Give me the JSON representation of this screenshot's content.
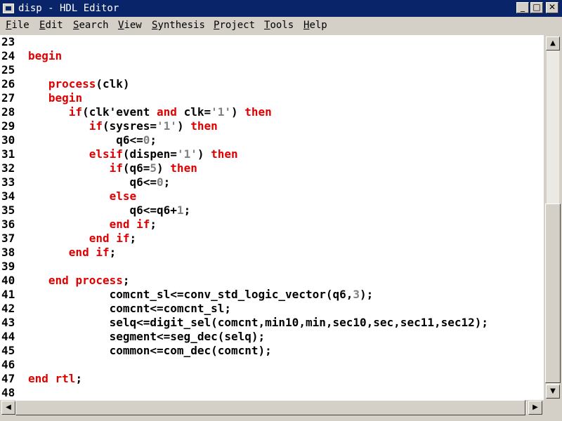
{
  "window": {
    "title": "disp - HDL Editor",
    "minimize_icon": "minimize-icon",
    "maximize_icon": "maximize-icon",
    "close_icon": "close-icon"
  },
  "menu": [
    "File",
    "Edit",
    "Search",
    "View",
    "Synthesis",
    "Project",
    "Tools",
    "Help"
  ],
  "colors": {
    "keyword": "#e00000",
    "text": "#000000",
    "literal": "#808080",
    "titlebar": "#0a246a"
  },
  "editor": {
    "lines": [
      {
        "num": "23",
        "tokens": []
      },
      {
        "num": "24",
        "tokens": [
          {
            "t": "begin",
            "c": "k"
          }
        ]
      },
      {
        "num": "25",
        "tokens": []
      },
      {
        "num": "26",
        "tokens": [
          {
            "t": "   ",
            "c": "n"
          },
          {
            "t": "process",
            "c": "k"
          },
          {
            "t": "(clk)",
            "c": "n"
          }
        ]
      },
      {
        "num": "27",
        "tokens": [
          {
            "t": "   ",
            "c": "n"
          },
          {
            "t": "begin",
            "c": "k"
          }
        ]
      },
      {
        "num": "28",
        "tokens": [
          {
            "t": "      ",
            "c": "n"
          },
          {
            "t": "if",
            "c": "k"
          },
          {
            "t": "(clk'event ",
            "c": "n"
          },
          {
            "t": "and",
            "c": "k"
          },
          {
            "t": " clk=",
            "c": "n"
          },
          {
            "t": "'1'",
            "c": "v"
          },
          {
            "t": ") ",
            "c": "n"
          },
          {
            "t": "then",
            "c": "k"
          }
        ]
      },
      {
        "num": "29",
        "tokens": [
          {
            "t": "         ",
            "c": "n"
          },
          {
            "t": "if",
            "c": "k"
          },
          {
            "t": "(sysres=",
            "c": "n"
          },
          {
            "t": "'1'",
            "c": "v"
          },
          {
            "t": ") ",
            "c": "n"
          },
          {
            "t": "then",
            "c": "k"
          }
        ]
      },
      {
        "num": "30",
        "tokens": [
          {
            "t": "             q6<=",
            "c": "n"
          },
          {
            "t": "0",
            "c": "v"
          },
          {
            "t": ";",
            "c": "n"
          }
        ]
      },
      {
        "num": "31",
        "tokens": [
          {
            "t": "         ",
            "c": "n"
          },
          {
            "t": "elsif",
            "c": "k"
          },
          {
            "t": "(dispen=",
            "c": "n"
          },
          {
            "t": "'1'",
            "c": "v"
          },
          {
            "t": ") ",
            "c": "n"
          },
          {
            "t": "then",
            "c": "k"
          }
        ]
      },
      {
        "num": "32",
        "tokens": [
          {
            "t": "            ",
            "c": "n"
          },
          {
            "t": "if",
            "c": "k"
          },
          {
            "t": "(q6=",
            "c": "n"
          },
          {
            "t": "5",
            "c": "v"
          },
          {
            "t": ") ",
            "c": "n"
          },
          {
            "t": "then",
            "c": "k"
          }
        ]
      },
      {
        "num": "33",
        "tokens": [
          {
            "t": "               q6<=",
            "c": "n"
          },
          {
            "t": "0",
            "c": "v"
          },
          {
            "t": ";",
            "c": "n"
          }
        ]
      },
      {
        "num": "34",
        "tokens": [
          {
            "t": "            ",
            "c": "n"
          },
          {
            "t": "else",
            "c": "k"
          }
        ]
      },
      {
        "num": "35",
        "tokens": [
          {
            "t": "               q6<=q6+",
            "c": "n"
          },
          {
            "t": "1",
            "c": "v"
          },
          {
            "t": ";",
            "c": "n"
          }
        ]
      },
      {
        "num": "36",
        "tokens": [
          {
            "t": "            ",
            "c": "n"
          },
          {
            "t": "end if",
            "c": "k"
          },
          {
            "t": ";",
            "c": "n"
          }
        ]
      },
      {
        "num": "37",
        "tokens": [
          {
            "t": "         ",
            "c": "n"
          },
          {
            "t": "end if",
            "c": "k"
          },
          {
            "t": ";",
            "c": "n"
          }
        ]
      },
      {
        "num": "38",
        "tokens": [
          {
            "t": "      ",
            "c": "n"
          },
          {
            "t": "end if",
            "c": "k"
          },
          {
            "t": ";",
            "c": "n"
          }
        ]
      },
      {
        "num": "39",
        "tokens": []
      },
      {
        "num": "40",
        "tokens": [
          {
            "t": "   ",
            "c": "n"
          },
          {
            "t": "end process",
            "c": "k"
          },
          {
            "t": ";",
            "c": "n"
          }
        ]
      },
      {
        "num": "41",
        "tokens": [
          {
            "t": "            comcnt_sl<=conv_std_logic_vector(q6,",
            "c": "n"
          },
          {
            "t": "3",
            "c": "v"
          },
          {
            "t": ");",
            "c": "n"
          }
        ]
      },
      {
        "num": "42",
        "tokens": [
          {
            "t": "            comcnt<=comcnt_sl;",
            "c": "n"
          }
        ]
      },
      {
        "num": "43",
        "tokens": [
          {
            "t": "            selq<=digit_sel(comcnt,min10,min,sec10,sec,sec11,sec12);",
            "c": "n"
          }
        ]
      },
      {
        "num": "44",
        "tokens": [
          {
            "t": "            segment<=seg_dec(selq);",
            "c": "n"
          }
        ]
      },
      {
        "num": "45",
        "tokens": [
          {
            "t": "            common<=com_dec(comcnt);",
            "c": "n"
          }
        ]
      },
      {
        "num": "46",
        "tokens": []
      },
      {
        "num": "47",
        "tokens": [
          {
            "t": "end rtl",
            "c": "k"
          },
          {
            "t": ";",
            "c": "n"
          }
        ]
      },
      {
        "num": "48",
        "tokens": []
      }
    ]
  },
  "scrollbars": {
    "vertical": {
      "position_fraction": 0.55,
      "visible_fraction": 0.54
    },
    "horizontal": {
      "position_fraction": 0.0,
      "visible_fraction": 1.0
    }
  }
}
